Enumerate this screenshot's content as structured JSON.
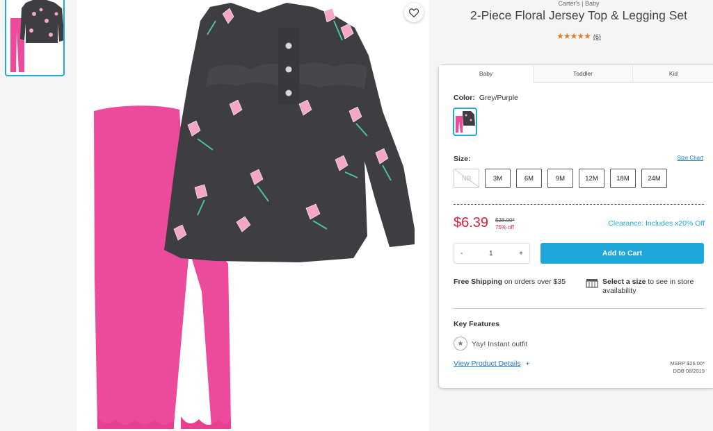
{
  "product": {
    "brand": "Carter's | Baby",
    "title": "2-Piece Floral Jersey Top & Legging Set",
    "rating_stars": "★★★★★",
    "review_count": "(6)"
  },
  "tabs": [
    {
      "label": "Baby"
    },
    {
      "label": "Toddler"
    },
    {
      "label": "Kid"
    }
  ],
  "color": {
    "label": "Color:",
    "value": "Grey/Purple"
  },
  "size": {
    "label": "Size:",
    "chart_link": "Size Chart",
    "options": [
      "NB",
      "3M",
      "6M",
      "9M",
      "12M",
      "18M",
      "24M"
    ]
  },
  "price": {
    "current": "$6.39",
    "original": "$28.00*",
    "discount": "75% off",
    "promo": "Clearance: Includes x20% Off"
  },
  "quantity": {
    "minus": "-",
    "value": "1",
    "plus": "+"
  },
  "cart": {
    "label": "Add to Cart"
  },
  "shipping": {
    "bold": "Free Shipping",
    "rest": " on orders over $35"
  },
  "store": {
    "bold": "Select a size",
    "rest": " to see in store availability"
  },
  "features": {
    "heading": "Key Features",
    "item": "Yay! Instant outfit"
  },
  "details": {
    "link": "View Product Details",
    "plus": "+"
  },
  "meta": {
    "msrp": "MSRP $26.00*",
    "dob": "DOB 08/2019"
  },
  "colors": {
    "accent": "#1fa7d9",
    "sale": "#d8213d",
    "top": "#3d3d42",
    "legging": "#ec4a9a"
  }
}
